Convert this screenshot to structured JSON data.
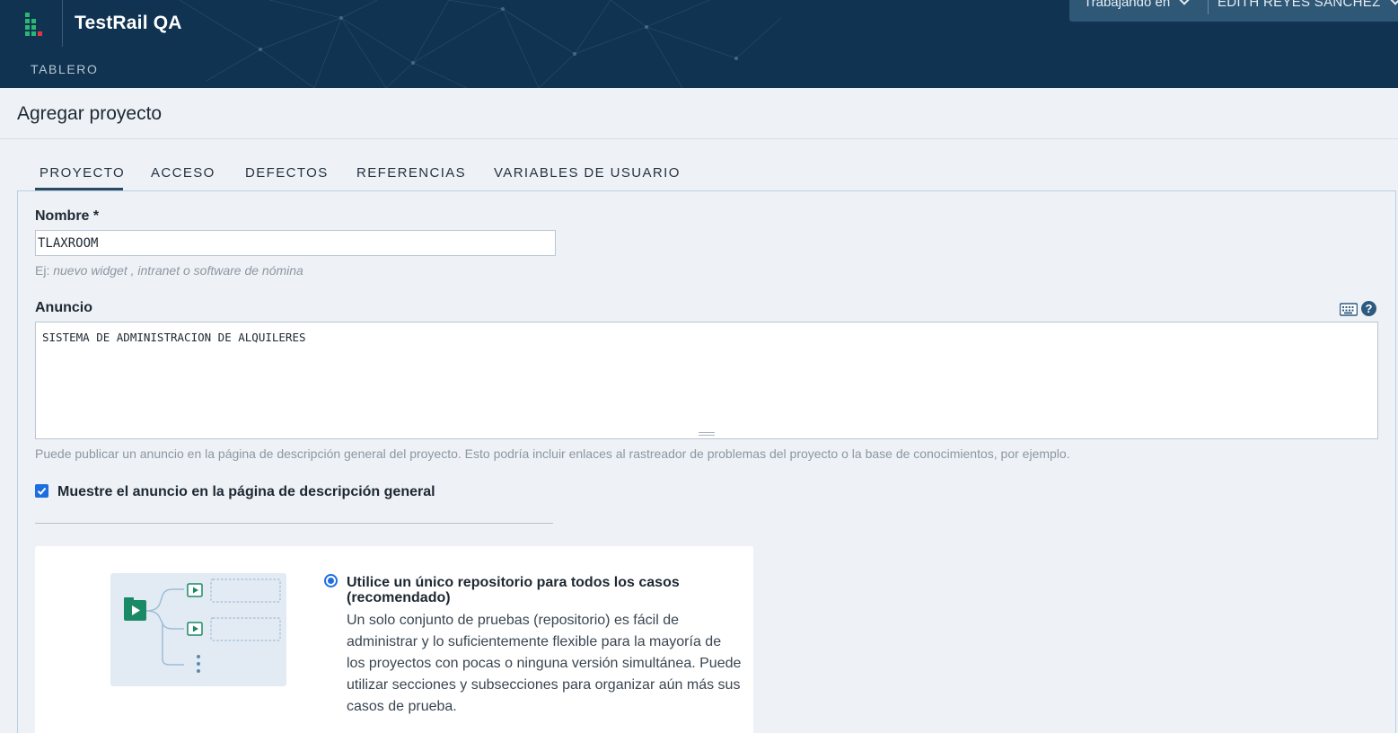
{
  "header": {
    "app_title": "TestRail QA",
    "nav_item": "TABLERO",
    "working_in_label": "Trabajando en",
    "user_name": "EDITH REYES SANCHEZ",
    "colors": {
      "background": "#0f3350",
      "logo_green": "#2bb673",
      "logo_red": "#e4344a"
    }
  },
  "page": {
    "title": "Agregar proyecto"
  },
  "tabs": [
    {
      "label": "PROYECTO",
      "active": true
    },
    {
      "label": "ACCESO",
      "active": false
    },
    {
      "label": "DEFECTOS",
      "active": false
    },
    {
      "label": "REFERENCIAS",
      "active": false
    },
    {
      "label": "VARIABLES DE USUARIO",
      "active": false
    }
  ],
  "form": {
    "name": {
      "label": "Nombre *",
      "value": "TLAXROOM",
      "hint_prefix": "Ej:",
      "hint_example": "nuevo widget , intranet o software de nómina"
    },
    "announcement": {
      "label": "Anuncio",
      "value": "SISTEMA DE ADMINISTRACION DE ALQUILERES",
      "hint": "Puede publicar un anuncio en la página de descripción general del proyecto. Esto podría incluir enlaces al rastreador de problemas del proyecto o la base de conocimientos, por ejemplo.",
      "icons": [
        "keyboard-icon",
        "help-icon"
      ]
    },
    "show_announcement": {
      "label": "Muestre el anuncio en la página de descripción general",
      "checked": true
    },
    "repository_option": {
      "selected": true,
      "title": "Utilice un único repositorio para todos los casos (recomendado)",
      "description": "Un solo conjunto de pruebas (repositorio) es fácil de administrar y lo suficientemente flexible para la mayoría de los proyectos con pocas o ninguna versión simultánea. Puede utilizar secciones y subsecciones para organizar aún más sus casos de prueba."
    }
  },
  "colors": {
    "accent": "#1d6fe0",
    "illustration_green": "#1a8a66"
  }
}
